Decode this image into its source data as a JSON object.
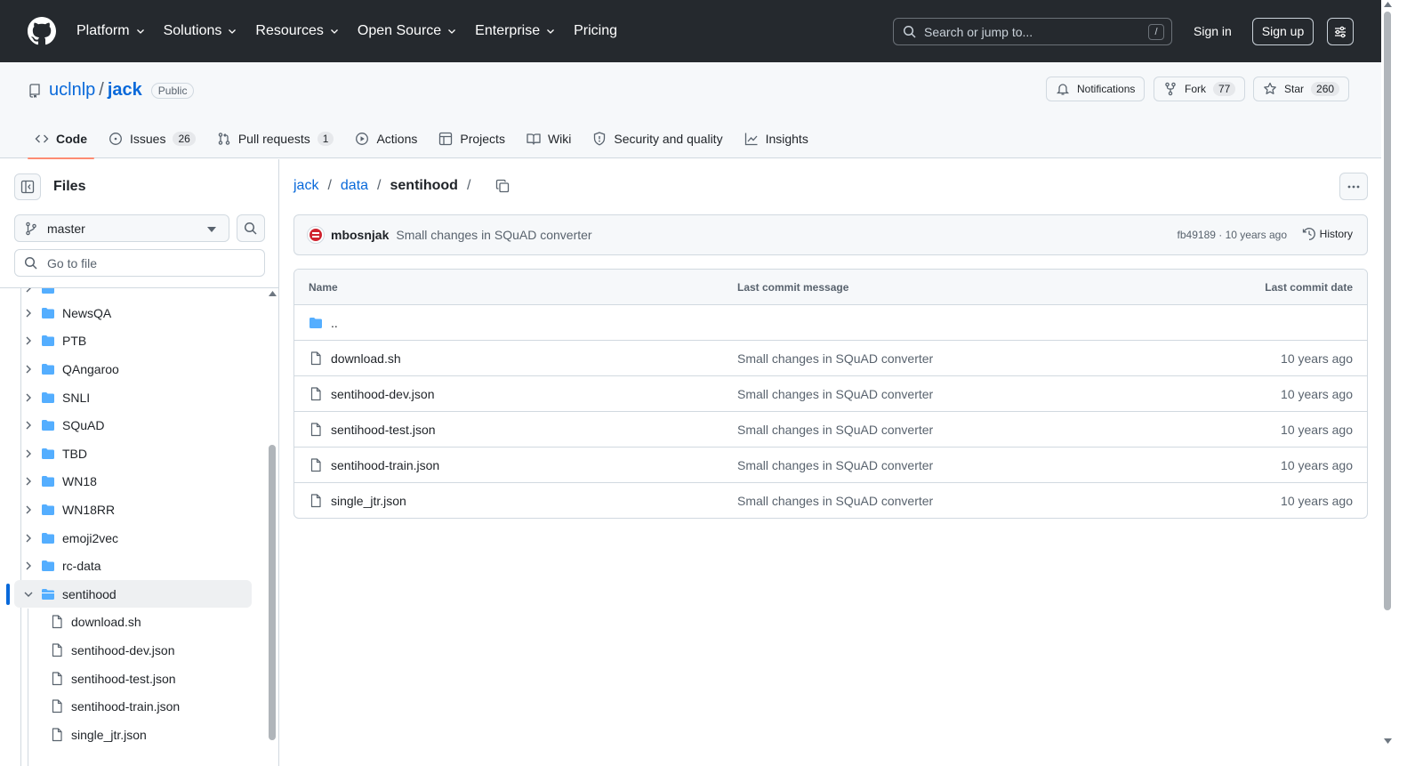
{
  "topnav": {
    "items": [
      {
        "label": "Platform",
        "dropdown": true
      },
      {
        "label": "Solutions",
        "dropdown": true
      },
      {
        "label": "Resources",
        "dropdown": true
      },
      {
        "label": "Open Source",
        "dropdown": true
      },
      {
        "label": "Enterprise",
        "dropdown": true
      },
      {
        "label": "Pricing",
        "dropdown": false
      }
    ],
    "search_placeholder": "Search or jump to...",
    "search_key": "/",
    "signin": "Sign in",
    "signup": "Sign up"
  },
  "repo": {
    "owner": "uclnlp",
    "separator": "/",
    "name": "jack",
    "visibility": "Public",
    "notifications_label": "Notifications",
    "fork_label": "Fork",
    "fork_count": "77",
    "star_label": "Star",
    "star_count": "260"
  },
  "tabs": [
    {
      "label": "Code",
      "icon": "code-icon",
      "active": true
    },
    {
      "label": "Issues",
      "icon": "issue-icon",
      "count": "26"
    },
    {
      "label": "Pull requests",
      "icon": "pull-request-icon",
      "count": "1"
    },
    {
      "label": "Actions",
      "icon": "play-icon"
    },
    {
      "label": "Projects",
      "icon": "table-icon"
    },
    {
      "label": "Wiki",
      "icon": "book-icon"
    },
    {
      "label": "Security and quality",
      "icon": "shield-icon"
    },
    {
      "label": "Insights",
      "icon": "graph-icon"
    }
  ],
  "sidebar": {
    "title": "Files",
    "branch": "master",
    "goto_placeholder": "Go to file",
    "folders": [
      "NewsQA",
      "PTB",
      "QAngaroo",
      "SNLI",
      "SQuAD",
      "TBD",
      "WN18",
      "WN18RR",
      "emoji2vec",
      "rc-data"
    ],
    "open_folder": "sentihood",
    "files": [
      "download.sh",
      "sentihood-dev.json",
      "sentihood-test.json",
      "sentihood-train.json",
      "single_jtr.json"
    ]
  },
  "breadcrumb": {
    "parts": [
      "jack",
      "data",
      "sentihood"
    ],
    "separator": "/"
  },
  "commit": {
    "author": "mbosnjak",
    "message": "Small changes in SQuAD converter",
    "sha": "fb49189",
    "meta_sep": " · ",
    "time": "10 years ago",
    "history_label": "History"
  },
  "table": {
    "headers": {
      "name": "Name",
      "message": "Last commit message",
      "date": "Last commit date"
    },
    "parent": "..",
    "rows": [
      {
        "name": "download.sh",
        "message": "Small changes in SQuAD converter",
        "date": "10 years ago"
      },
      {
        "name": "sentihood-dev.json",
        "message": "Small changes in SQuAD converter",
        "date": "10 years ago"
      },
      {
        "name": "sentihood-test.json",
        "message": "Small changes in SQuAD converter",
        "date": "10 years ago"
      },
      {
        "name": "sentihood-train.json",
        "message": "Small changes in SQuAD converter",
        "date": "10 years ago"
      },
      {
        "name": "single_jtr.json",
        "message": "Small changes in SQuAD converter",
        "date": "10 years ago"
      }
    ]
  },
  "colors": {
    "header_bg": "#25292e",
    "link": "#0969da",
    "folder": "#54aeff",
    "active_tab_underline": "#fd8c73"
  }
}
